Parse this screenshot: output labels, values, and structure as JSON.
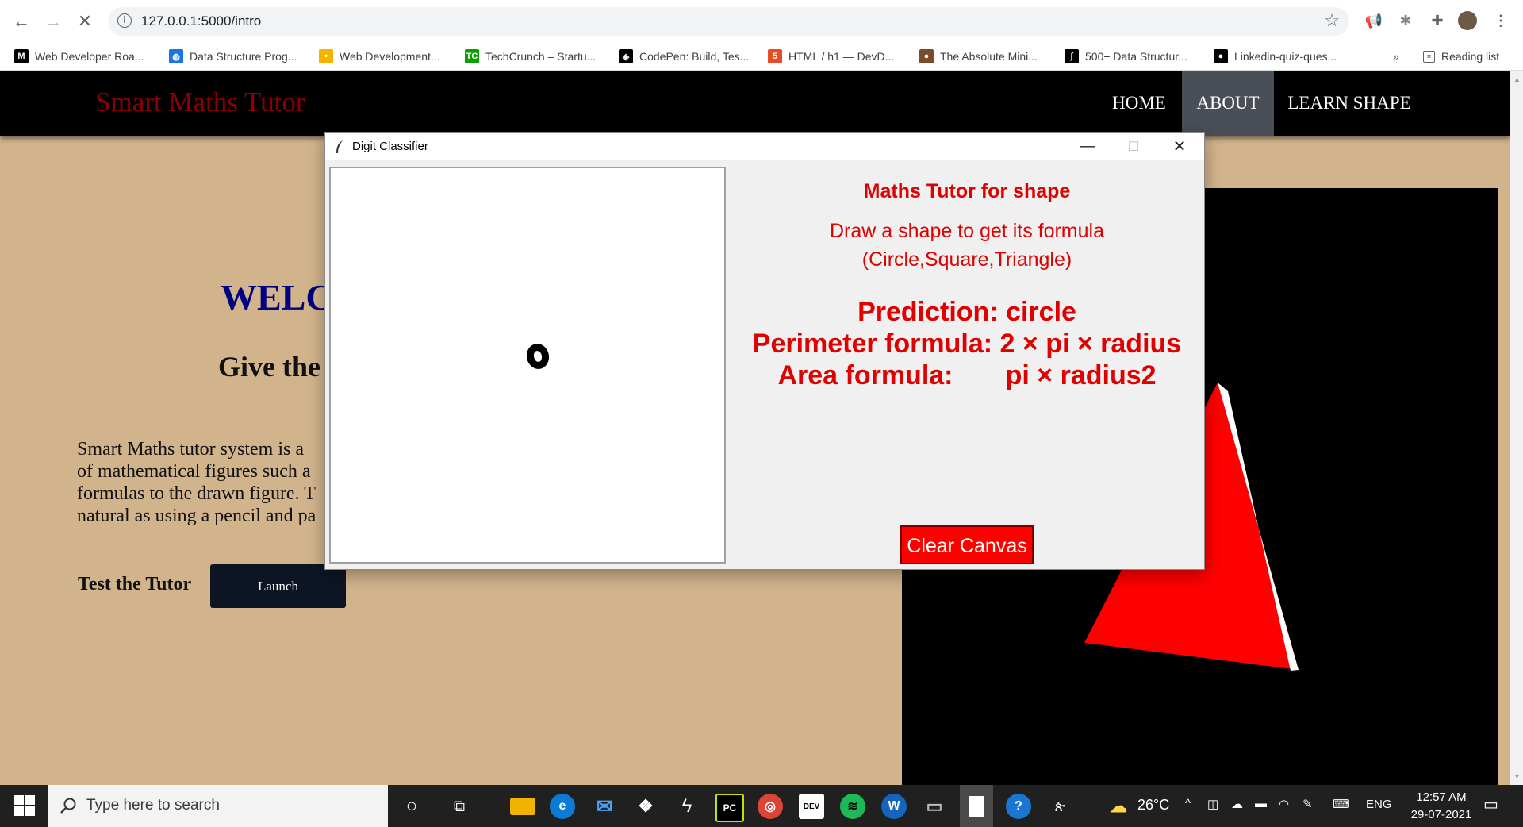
{
  "browser": {
    "url": "127.0.0.1:5000/intro",
    "reading_list_label": "Reading list",
    "more_bookmarks": "»",
    "bookmarks": [
      {
        "label": "Web Developer Roa...",
        "icon": "medium-icon",
        "color": "#000000",
        "glyph": "M"
      },
      {
        "label": "Data Structure Prog...",
        "icon": "globe-icon",
        "color": "#1a73e8",
        "glyph": "◍"
      },
      {
        "label": "Web Development...",
        "icon": "bulb-icon",
        "color": "#f4b400",
        "glyph": "•"
      },
      {
        "label": "TechCrunch – Startu...",
        "icon": "techcrunch-icon",
        "color": "#0a9e01",
        "glyph": "TC"
      },
      {
        "label": "CodePen: Build, Tes...",
        "icon": "codepen-icon",
        "color": "#000000",
        "glyph": "◈"
      },
      {
        "label": "HTML / h1 — DevD...",
        "icon": "html-icon",
        "color": "#e44d26",
        "glyph": "5"
      },
      {
        "label": "The Absolute Mini...",
        "icon": "avatar-icon",
        "color": "#7a4a2a",
        "glyph": "●"
      },
      {
        "label": "500+ Data Structur...",
        "icon": "bracket-icon",
        "color": "#000000",
        "glyph": "ʃ"
      },
      {
        "label": "Linkedin-quiz-ques...",
        "icon": "github-icon",
        "color": "#000000",
        "glyph": "●"
      }
    ]
  },
  "site": {
    "brand": "Smart Maths Tutor",
    "nav": [
      "HOME",
      "ABOUT",
      "LEARN SHAPE"
    ],
    "active_nav": "ABOUT",
    "welcome": "WELC",
    "tagline": "Give the",
    "paragraph": [
      "Smart Maths tutor system is a",
      "of mathematical figures such a",
      "formulas to the drawn figure. T",
      "natural as using a pencil and pa"
    ],
    "test_label": "Test the Tutor",
    "launch_label": "Launch"
  },
  "tk_window": {
    "title": "Digit Classifier",
    "heading": "Maths Tutor for shape",
    "instruction": "Draw a shape to get its formula",
    "shapes": "(Circle,Square,Triangle)",
    "prediction": "Prediction: circle",
    "perimeter": "Perimeter formula: 2 × pi × radius",
    "area": "Area formula:       pi × radius2",
    "clear_button": "Clear Canvas"
  },
  "taskbar": {
    "search_placeholder": "Type here to search",
    "temperature": "26°C",
    "language": "ENG",
    "time": "12:57 AM",
    "date": "29-07-2021"
  },
  "colors": {
    "page_bg": "#d2b48c",
    "brand": "#8b0000",
    "welcome": "#000080",
    "tk_text": "#e00000",
    "clear_button": "#ff0000"
  }
}
